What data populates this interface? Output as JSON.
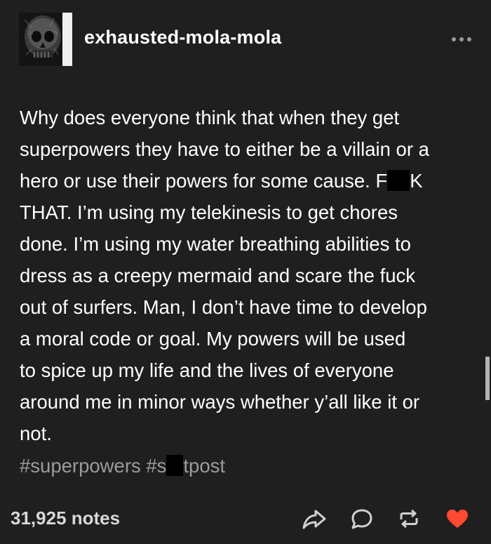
{
  "post": {
    "username": "exhausted-mola-mola",
    "body_lines": [
      [
        "Why does everyone think that when they get"
      ],
      [
        "superpowers they have to either be a villain or a"
      ],
      [
        "hero or use their powers for some cause. F",
        "K"
      ],
      [
        "THAT. I’m using my telekinesis to get chores"
      ],
      [
        "done. I’m using my water breathing abilities to"
      ],
      [
        "dress as a creepy mermaid and scare the fuck"
      ],
      [
        "out of surfers. Man, I don’t have time to develop"
      ],
      [
        "a moral code or goal. My powers will be used"
      ],
      [
        "to spice up my life and the lives of everyone"
      ],
      [
        "around me in minor ways whether y’all like it or"
      ],
      [
        "not."
      ]
    ],
    "tags": {
      "tag1": "#superpowers",
      "tag2_start": "#s",
      "tag2_end": "tpost"
    },
    "notes": "31,925 notes"
  },
  "icons": {
    "more": "more-dots-icon",
    "share": "share-arrow-icon",
    "reply": "reply-bubble-icon",
    "reblog": "reblog-icon",
    "like": "heart-icon"
  },
  "colors": {
    "background": "#1f1f1f",
    "text": "#ffffff",
    "tags": "#9b9b9b",
    "like": "#ff4930"
  }
}
